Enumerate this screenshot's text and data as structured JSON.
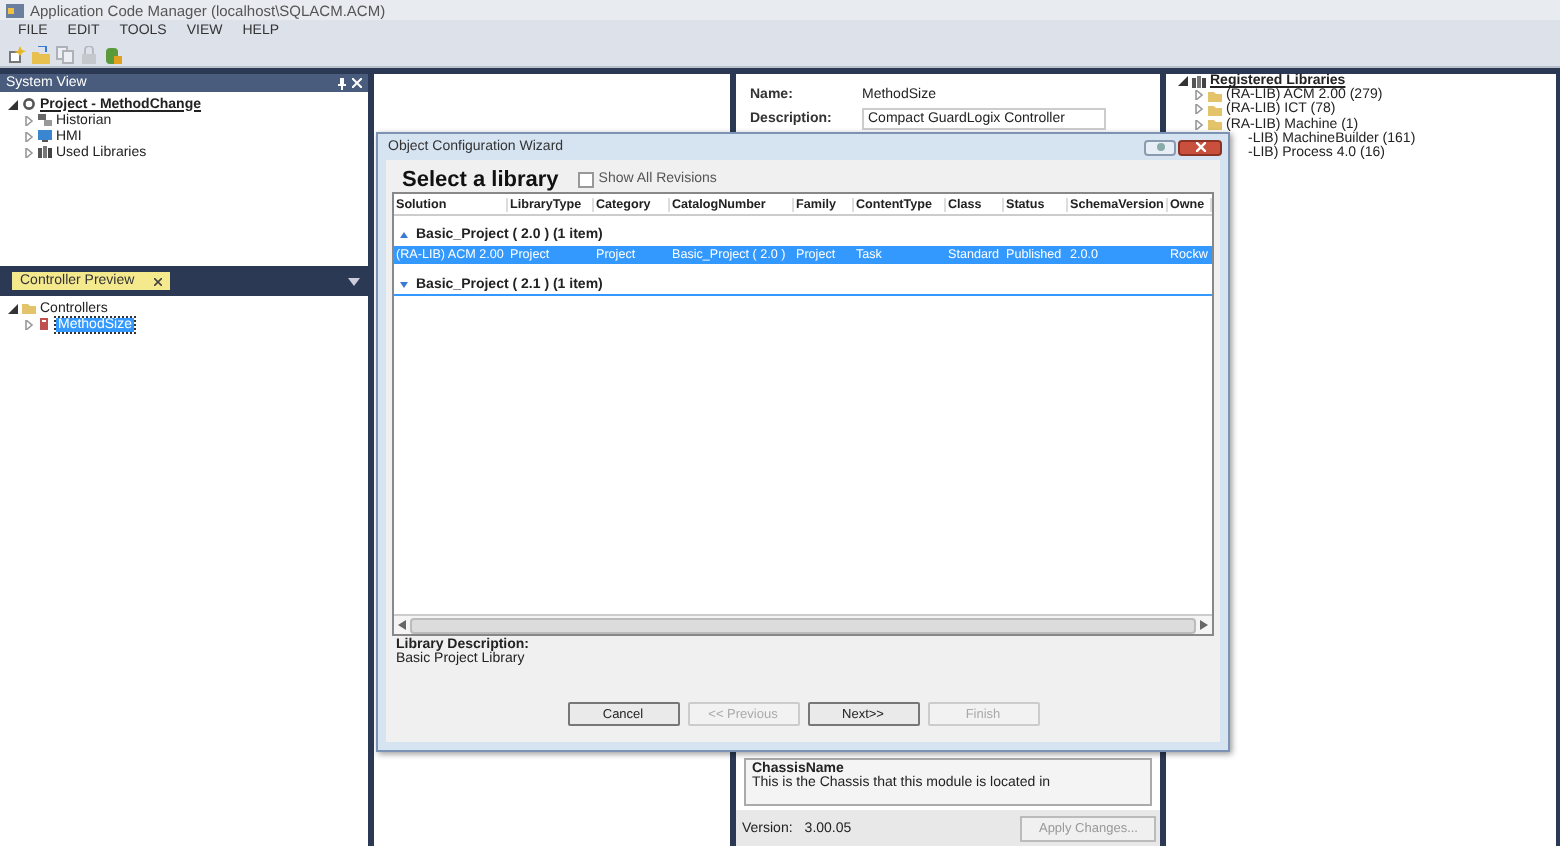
{
  "window": {
    "title": "Application Code Manager (localhost\\SQLACM.ACM)"
  },
  "menu": [
    "FILE",
    "EDIT",
    "TOOLS",
    "VIEW",
    "HELP"
  ],
  "toolbar": [
    {
      "disabled": false
    },
    {
      "disabled": false
    },
    {
      "disabled": true
    },
    {
      "disabled": true
    },
    {
      "disabled": false
    }
  ],
  "system_view": {
    "title": "System View",
    "tree": [
      {
        "label": "Project - MethodChange",
        "expanded": true,
        "children": [
          {
            "label": "Historian",
            "expanded": false
          },
          {
            "label": "HMI",
            "expanded": false
          },
          {
            "label": "Used Libraries",
            "expanded": false
          }
        ]
      }
    ]
  },
  "controller_preview": {
    "tab": "Controller Preview",
    "tree": [
      {
        "label": "Controllers",
        "expanded": true,
        "children": [
          {
            "label": "MethodSize",
            "expanded": false,
            "selected": true
          }
        ]
      }
    ]
  },
  "properties": {
    "fields": [
      {
        "label": "Name:",
        "value": "MethodSize",
        "kind": "text"
      },
      {
        "label": "Description:",
        "value": "Compact GuardLogix Controller",
        "kind": "field"
      }
    ],
    "help": {
      "title": "ChassisName",
      "text": "This is the Chassis that this module is located in"
    },
    "version_label": "Version:",
    "version": "3.00.05",
    "apply_button": {
      "label": "Apply Changes...",
      "disabled": true
    }
  },
  "registered_libraries": {
    "title": "Registered Libraries",
    "expanded": true,
    "items": [
      {
        "label": "(RA-LIB) ACM 2.00  (279)",
        "kind": "folder",
        "expanded": false
      },
      {
        "label": "(RA-LIB) ICT  (78)",
        "kind": "folder",
        "expanded": false
      },
      {
        "label": "(RA-LIB) Machine  (1)",
        "kind": "folder",
        "expanded": false
      },
      {
        "label": "-LIB) MachineBuilder  (161)",
        "kind": "covered"
      },
      {
        "label": "-LIB) Process 4.0  (16)",
        "kind": "covered"
      }
    ]
  },
  "dialog": {
    "title": "Object Configuration Wizard",
    "heading": "Select a library",
    "show_all": {
      "label": "Show All Revisions",
      "checked": false
    },
    "columns": [
      "Solution",
      "LibraryType",
      "Category",
      "CatalogNumber",
      "Family",
      "ContentType",
      "Class",
      "Status",
      "SchemaVersion",
      "Owne"
    ],
    "groups": [
      {
        "title": "Basic_Project   ( 2.0 )    (1 item)",
        "expanded": true,
        "rows": [
          {
            "selected": true,
            "cells": [
              "(RA-LIB) ACM 2.00",
              "Project",
              "Project",
              "Basic_Project ( 2.0 )",
              "Project",
              "Task",
              "Standard",
              "Published",
              "2.0.0",
              "Rockw"
            ]
          }
        ]
      },
      {
        "title": "Basic_Project   ( 2.1 )    (1 item)",
        "expanded": false
      }
    ],
    "description_label": "Library Description:",
    "description": "Basic Project Library",
    "buttons": [
      {
        "label": "Cancel",
        "disabled": false
      },
      {
        "label": "<< Previous",
        "disabled": true
      },
      {
        "label": "Next>>",
        "disabled": false
      },
      {
        "label": "Finish",
        "disabled": true
      }
    ]
  }
}
